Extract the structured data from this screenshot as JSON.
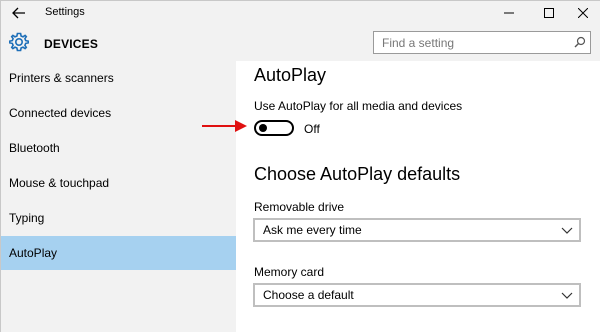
{
  "window": {
    "title": "Settings",
    "back_icon": "back-arrow-icon",
    "controls": [
      "minimize-icon",
      "maximize-icon",
      "close-icon"
    ]
  },
  "header": {
    "section_title": "DEVICES",
    "icon": "gear-icon",
    "search": {
      "placeholder": "Find a setting",
      "value": "",
      "icon": "search-icon"
    }
  },
  "sidebar": {
    "items": [
      {
        "label": "Printers & scanners",
        "active": false
      },
      {
        "label": "Connected devices",
        "active": false
      },
      {
        "label": "Bluetooth",
        "active": false
      },
      {
        "label": "Mouse & touchpad",
        "active": false
      },
      {
        "label": "Typing",
        "active": false
      },
      {
        "label": "AutoPlay",
        "active": true
      }
    ]
  },
  "main": {
    "title": "AutoPlay",
    "toggle": {
      "label": "Use AutoPlay for all media and devices",
      "state_text": "Off",
      "on": false
    },
    "defaults_title": "Choose AutoPlay defaults",
    "removable_drive": {
      "label": "Removable drive",
      "value": "Ask me every time"
    },
    "memory_card": {
      "label": "Memory card",
      "value": "Choose a default"
    }
  },
  "colors": {
    "accent_selected": "#a6d1f0",
    "arrow": "#e01010"
  }
}
